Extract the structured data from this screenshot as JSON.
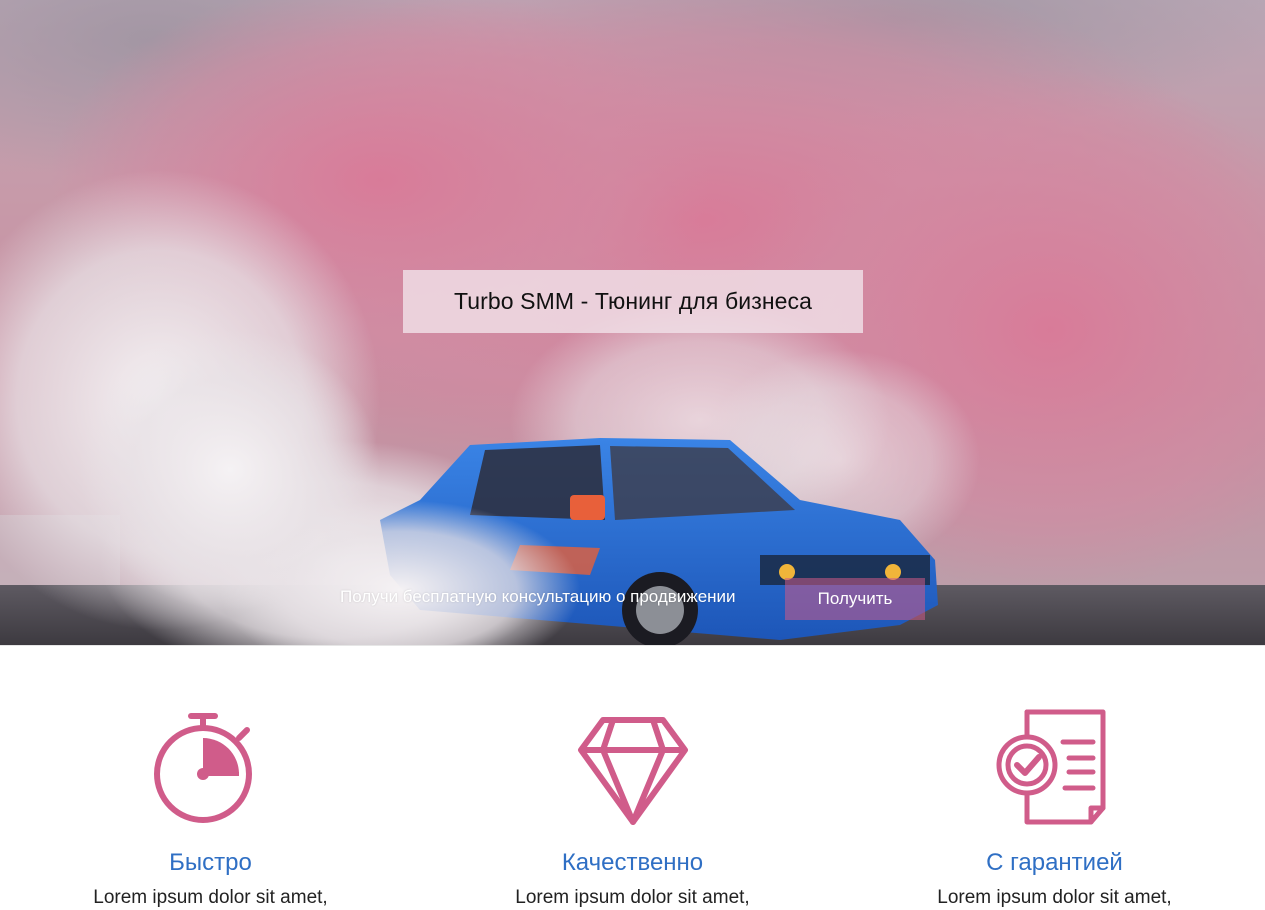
{
  "colors": {
    "accent": "#d05c8a",
    "feature_title": "#2f6fc4",
    "cta_button_bg": "#cd5a87",
    "title_box_bg": "#f0e1e8"
  },
  "hero": {
    "background_image": "blue drift car in pink and white smoke",
    "title": "Turbo SMM - Тюнинг для бизнеса",
    "cta_text": "Получи бесплатную консультацию о продвижении",
    "cta_button_label": "Получить"
  },
  "features": [
    {
      "icon": "stopwatch-icon",
      "title": "Быстро",
      "description": "Lorem ipsum dolor sit amet,"
    },
    {
      "icon": "diamond-icon",
      "title": "Качественно",
      "description": "Lorem ipsum dolor sit amet,"
    },
    {
      "icon": "guarantee-document-icon",
      "title": "С гарантией",
      "description": "Lorem ipsum dolor sit amet,"
    }
  ]
}
